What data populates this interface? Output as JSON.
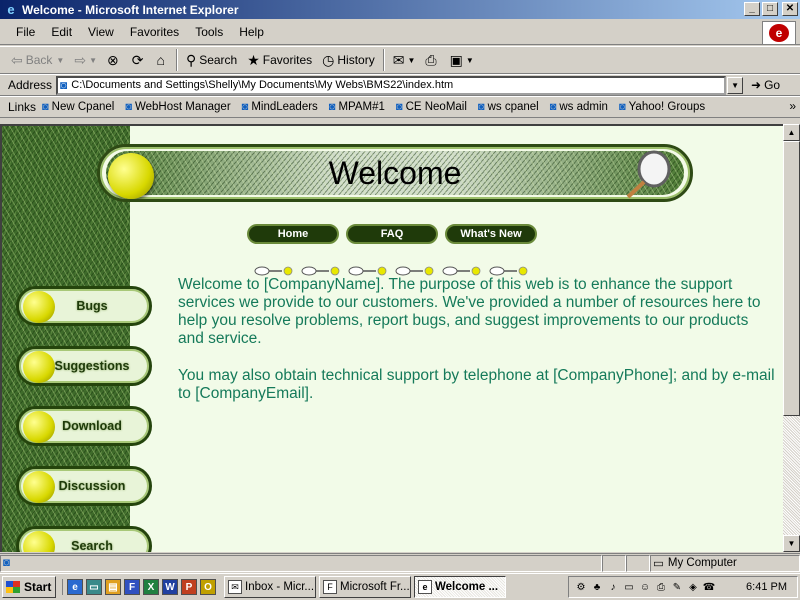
{
  "window": {
    "title": "Welcome - Microsoft Internet Explorer",
    "buttons": {
      "minimize": "_",
      "maximize": "□",
      "close": "✕"
    }
  },
  "menu": [
    "File",
    "Edit",
    "View",
    "Favorites",
    "Tools",
    "Help"
  ],
  "toolbar": {
    "back": "Back",
    "search": "Search",
    "favorites": "Favorites",
    "history": "History"
  },
  "address": {
    "label": "Address",
    "url": "C:\\Documents and Settings\\Shelly\\My Documents\\My Webs\\BMS22\\index.htm",
    "go": "Go"
  },
  "links": {
    "label": "Links",
    "items": [
      "New Cpanel",
      "WebHost Manager",
      "MindLeaders",
      "MPAM#1",
      "CE NeoMail",
      "ws cpanel",
      "ws admin",
      "Yahoo! Groups"
    ]
  },
  "page": {
    "banner_title": "Welcome",
    "nav": [
      "Home",
      "FAQ",
      "What's New"
    ],
    "side": [
      "Bugs",
      "Suggestions",
      "Download",
      "Discussion",
      "Search"
    ],
    "paragraphs": [
      "Welcome to [CompanyName]. The purpose of this web is to enhance the support services we provide to our customers. We've provided a number of resources here to help you resolve problems, report bugs, and suggest improvements to our products and service.",
      "You may also obtain technical support by telephone at [CompanyPhone]; and by e-mail to [CompanyEmail]."
    ]
  },
  "status": {
    "zone": "My Computer"
  },
  "taskbar": {
    "start": "Start",
    "tasks": [
      "Inbox - Micr...",
      "Microsoft Fr...",
      "Welcome ..."
    ],
    "clock": "6:41 PM"
  }
}
